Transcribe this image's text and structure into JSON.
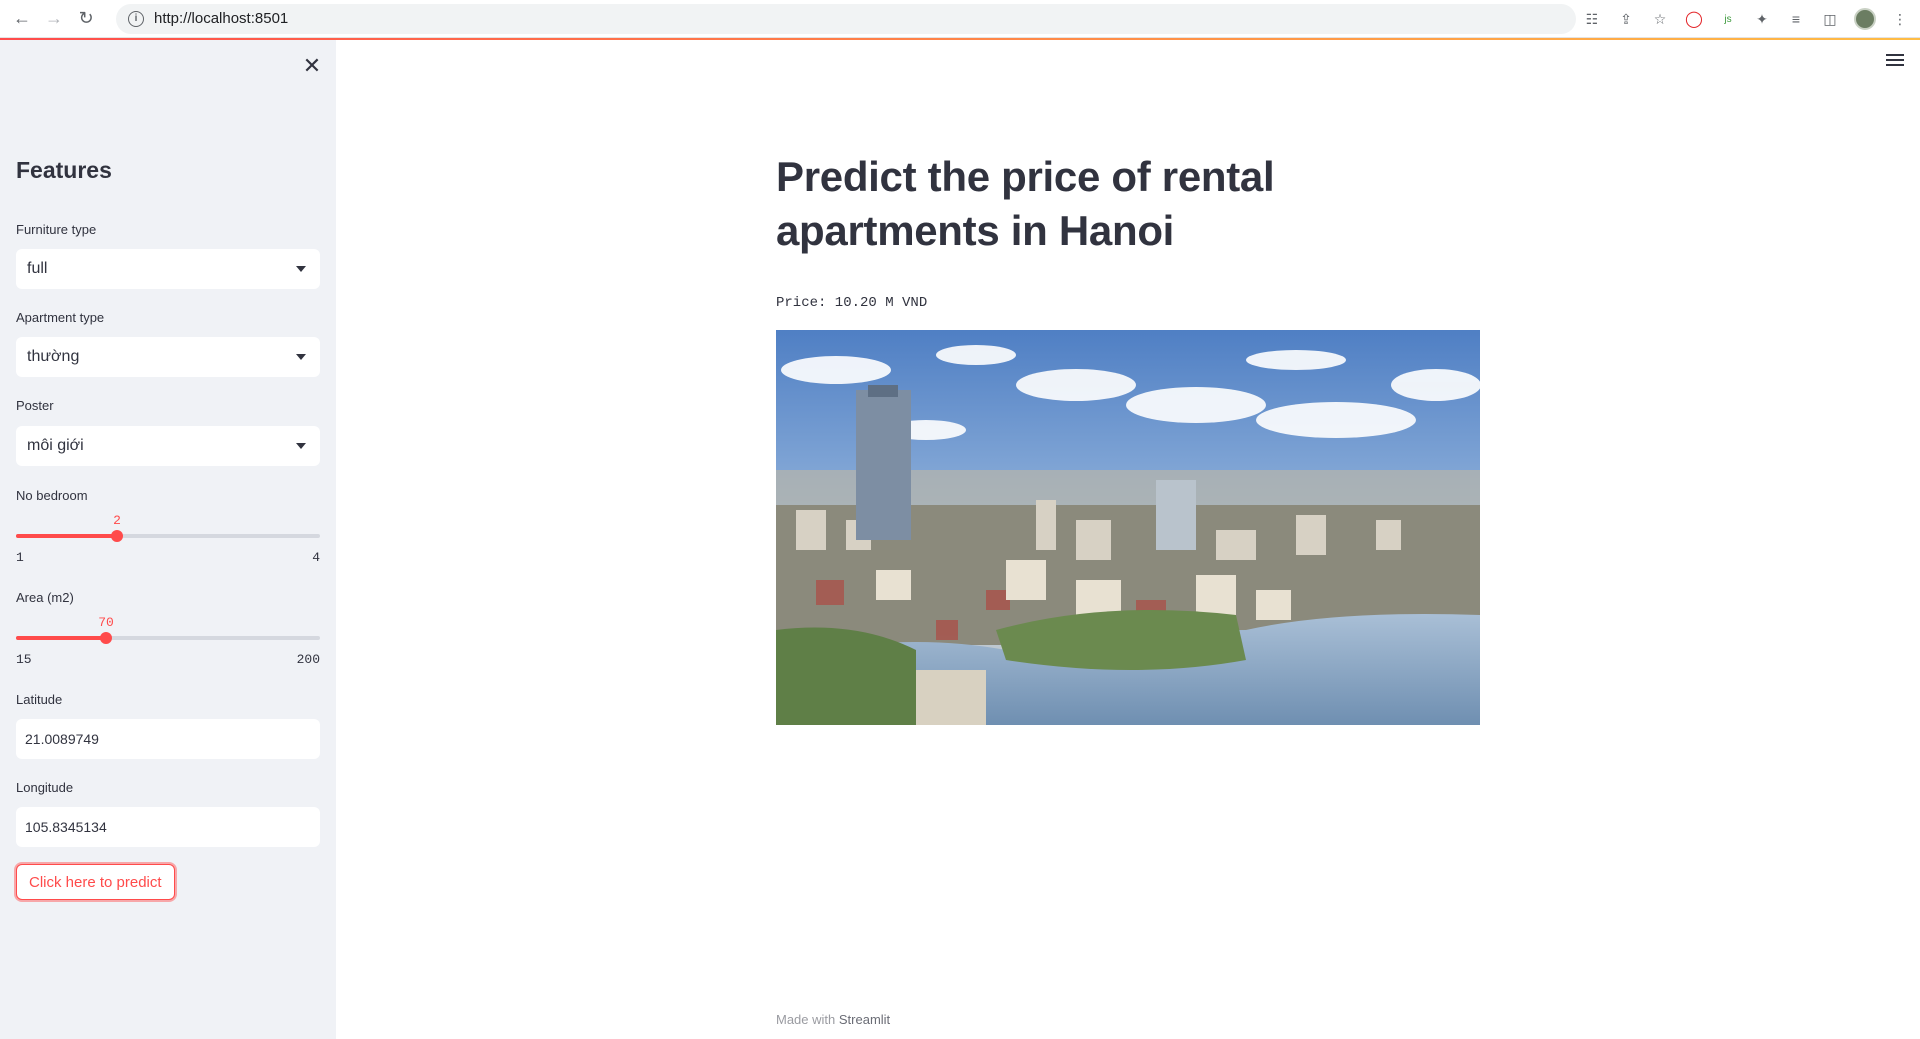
{
  "browser": {
    "url": "http://localhost:8501"
  },
  "sidebar": {
    "title": "Features",
    "furniture": {
      "label": "Furniture type",
      "value": "full"
    },
    "apartment": {
      "label": "Apartment type",
      "value": "thường"
    },
    "poster": {
      "label": "Poster",
      "value": "môi giới"
    },
    "bedroom": {
      "label": "No bedroom",
      "value": "2",
      "min": "1",
      "max": "4",
      "fraction": 0.3333
    },
    "area": {
      "label": "Area (m2)",
      "value": "70",
      "min": "15",
      "max": "200",
      "fraction": 0.2973
    },
    "latitude": {
      "label": "Latitude",
      "value": "21.0089749"
    },
    "longitude": {
      "label": "Longitude",
      "value": "105.8345134"
    },
    "predict_label": "Click here to predict"
  },
  "main": {
    "title": "Predict the price of rental apartments in Hanoi",
    "price_text": "Price: 10.20 M VND",
    "footer_prefix": "Made with",
    "footer_brand": "Streamlit"
  },
  "colors": {
    "accent": "#ff4b4b",
    "sidebar_bg": "#f0f2f6",
    "text": "#31333f"
  }
}
